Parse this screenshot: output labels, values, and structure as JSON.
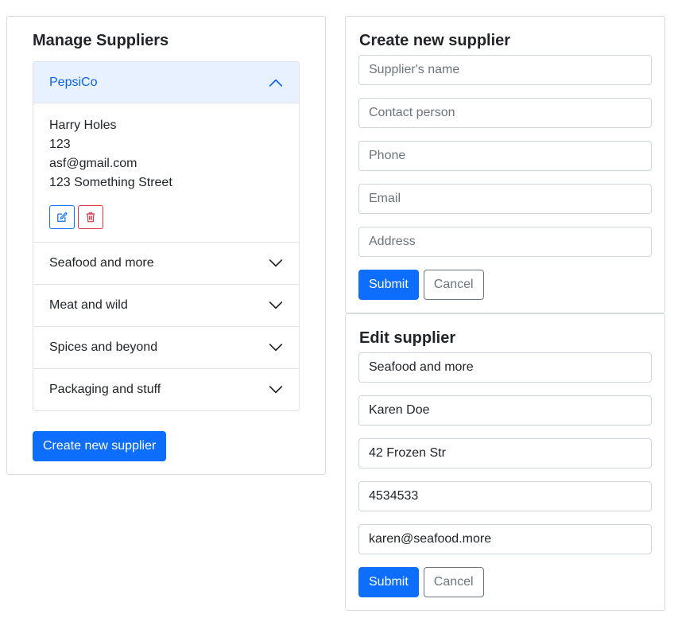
{
  "manage": {
    "title": "Manage Suppliers",
    "suppliers": [
      {
        "name": "PepsiCo",
        "expanded": true,
        "contact": "Harry Holes",
        "phone": "123",
        "email": "asf@gmail.com",
        "address": "123 Something Street"
      },
      {
        "name": "Seafood and more",
        "expanded": false
      },
      {
        "name": "Meat and wild",
        "expanded": false
      },
      {
        "name": "Spices and beyond",
        "expanded": false
      },
      {
        "name": "Packaging and stuff",
        "expanded": false
      }
    ],
    "create_button": "Create new supplier",
    "icons": {
      "edit": "pencil-square-icon",
      "delete": "trash-icon",
      "expand": "chevron-down-icon",
      "collapse": "chevron-up-icon"
    }
  },
  "create_form": {
    "title": "Create new supplier",
    "fields": [
      {
        "placeholder": "Supplier's name",
        "value": ""
      },
      {
        "placeholder": "Contact person",
        "value": ""
      },
      {
        "placeholder": "Phone",
        "value": ""
      },
      {
        "placeholder": "Email",
        "value": ""
      },
      {
        "placeholder": "Address",
        "value": ""
      }
    ],
    "submit": "Submit",
    "cancel": "Cancel"
  },
  "edit_form": {
    "title": "Edit supplier",
    "fields": [
      {
        "value": "Seafood and more"
      },
      {
        "value": "Karen Doe"
      },
      {
        "value": "42 Frozen Str"
      },
      {
        "value": "4534533"
      },
      {
        "value": "karen@seafood.more"
      }
    ],
    "submit": "Submit",
    "cancel": "Cancel"
  },
  "colors": {
    "primary": "#0d6efd",
    "danger": "#dc3545",
    "accordion_active_bg": "#e7f1ff",
    "accordion_active_text": "#0c63e4",
    "secondary": "#6c757d"
  }
}
